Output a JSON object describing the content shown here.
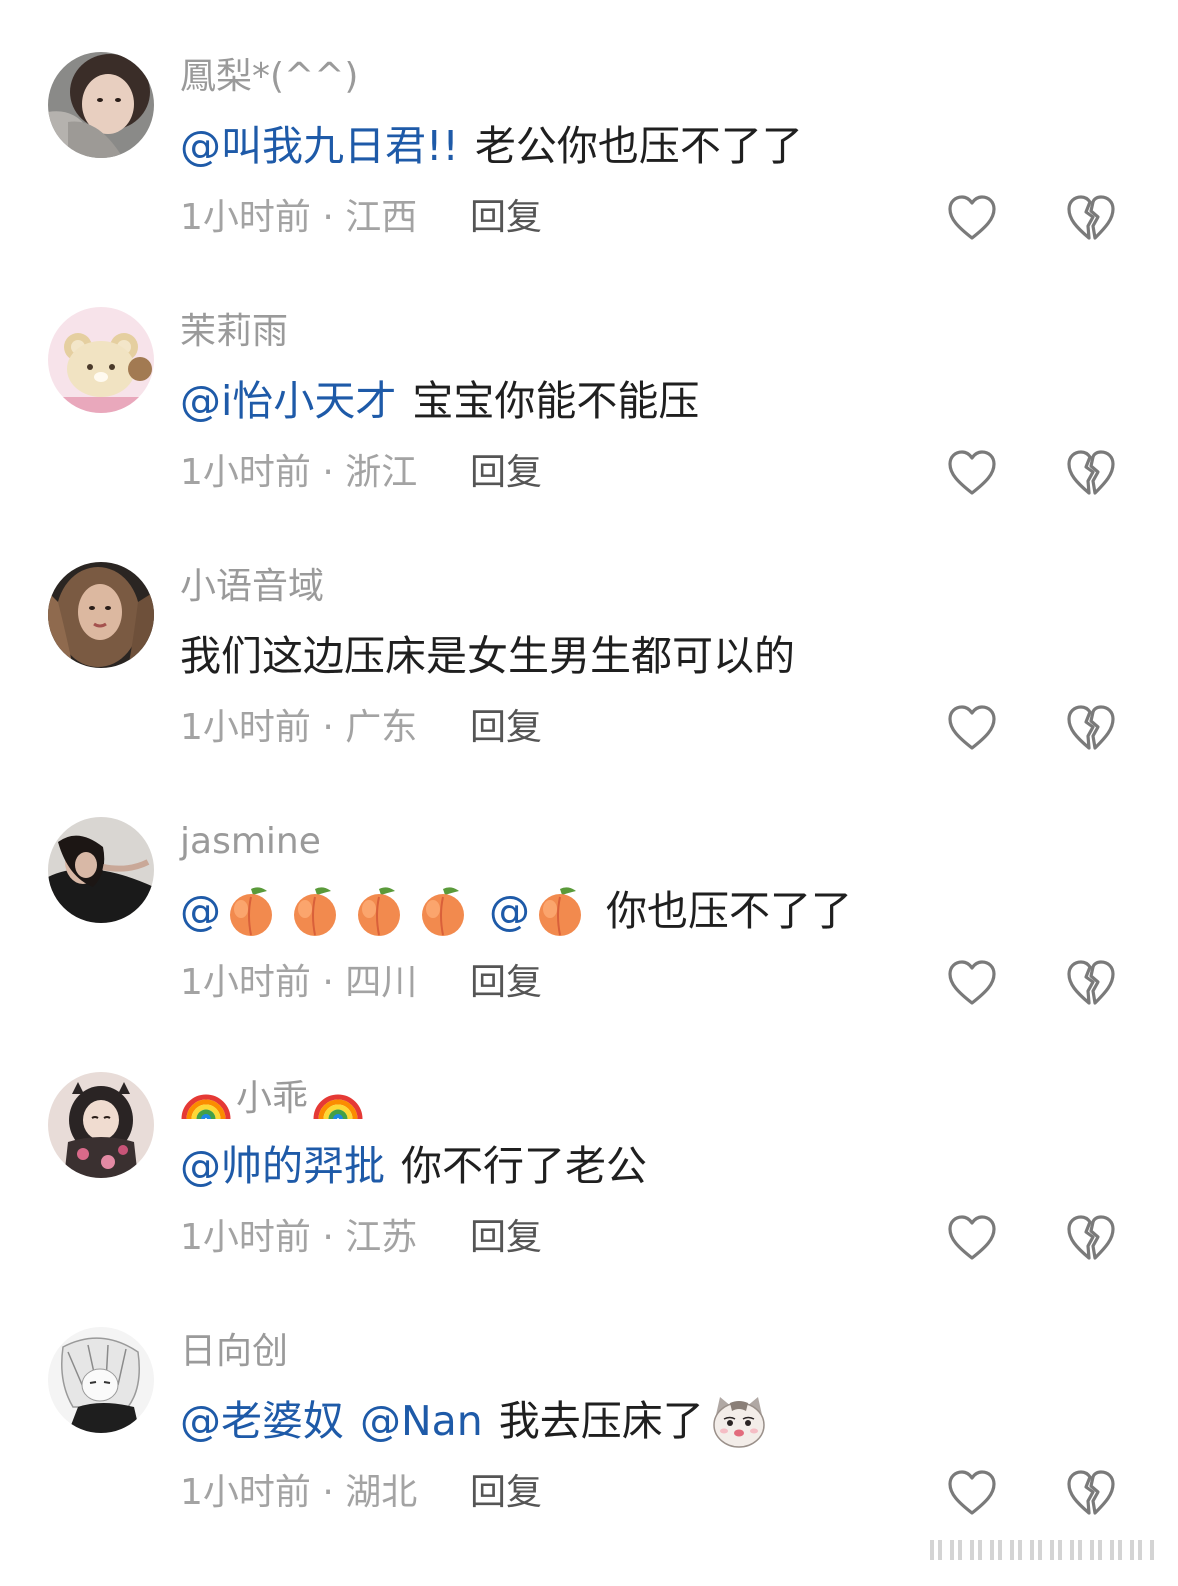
{
  "comments": [
    {
      "username": "鳳梨*(^^)",
      "mentions": [
        "@叫我九日君!!"
      ],
      "text": "老公你也压不了了",
      "time": "1小时前",
      "location": "江西",
      "reply_label": "回复",
      "avatar": "avatar-woman-scarf"
    },
    {
      "username": "茉莉雨",
      "mentions": [
        "@i怡小天才"
      ],
      "text": "宝宝你能不能压",
      "time": "1小时前",
      "location": "浙江",
      "reply_label": "回复",
      "avatar": "avatar-bear-cartoon"
    },
    {
      "username": "小语音域",
      "mentions": [],
      "text": "我们这边压床是女生男生都可以的",
      "time": "1小时前",
      "location": "广东",
      "reply_label": "回复",
      "avatar": "avatar-woman-curly-hair"
    },
    {
      "username": "jasmine",
      "mention_prefix": "@",
      "peach_count": 4,
      "second_mention_prefix": "@",
      "text": "你也压不了了",
      "time": "1小时前",
      "location": "四川",
      "reply_label": "回复",
      "avatar": "avatar-woman-dark-photo"
    },
    {
      "username": "小乖",
      "mentions": [
        "@帅的羿批"
      ],
      "text": "你不行了老公",
      "time": "1小时前",
      "location": "江苏",
      "reply_label": "回复",
      "avatar": "avatar-anime-girl-kimono"
    },
    {
      "username": "日向创",
      "mentions": [
        "@老婆奴",
        "@Nan"
      ],
      "text": "我去压床了",
      "time": "1小时前",
      "location": "湖北",
      "reply_label": "回复",
      "avatar": "avatar-anime-boy-monochrome"
    }
  ],
  "separator": "·",
  "icons": {
    "like": "heart-outline-icon",
    "dislike": "broken-heart-outline-icon",
    "peach": "peach-emoji-icon",
    "rainbow": "rainbow-emoji-icon",
    "cat": "cat-face-emoji-icon"
  },
  "colors": {
    "mention": "#1e5aa8",
    "username": "#9a9a9a",
    "text": "#1f1f1f",
    "meta": "#a3a3a3",
    "icon": "#7a7a7a"
  }
}
